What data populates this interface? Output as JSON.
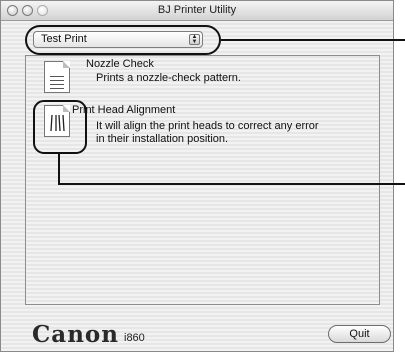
{
  "window": {
    "title": "BJ Printer Utility"
  },
  "menu": {
    "selected": "Test Print"
  },
  "items": [
    {
      "title": "Nozzle Check",
      "description": [
        "Prints a nozzle-check pattern."
      ]
    },
    {
      "title": "Print Head Alignment",
      "description": [
        "It will align the print heads to correct any error",
        "in their installation position."
      ]
    }
  ],
  "footer": {
    "brand": "Canon",
    "model": "i860",
    "quit_label": "Quit"
  }
}
